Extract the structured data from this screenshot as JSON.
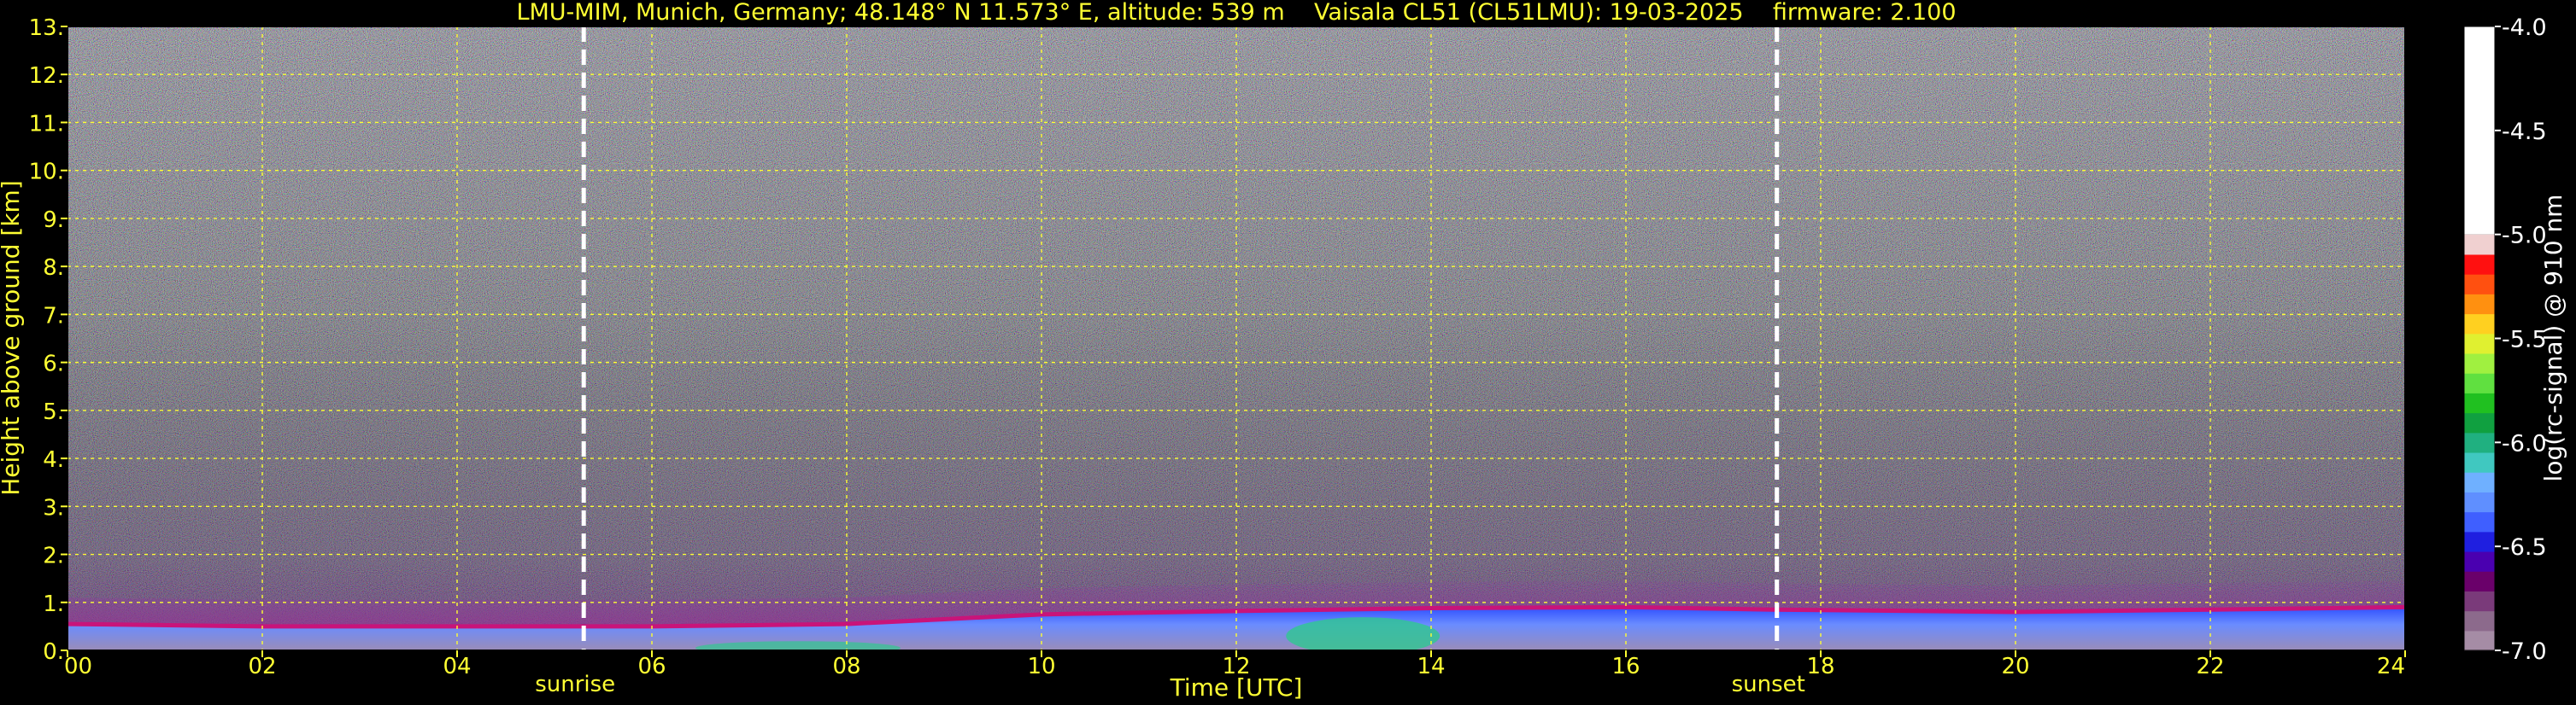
{
  "chart_data": {
    "type": "heatmap",
    "title": "LMU-MIM, Munich, Germany; 48.148° N 11.573° E, altitude: 539 m    Vaisala CL51 (CL51LMU): 19-03-2025    firmware: 2.100",
    "xlabel": "Time [UTC]",
    "ylabel": "Height above ground [km]",
    "xlim": [
      0,
      24
    ],
    "ylim": [
      0,
      13
    ],
    "x_ticks": [
      {
        "value": 0,
        "label": "00"
      },
      {
        "value": 2,
        "label": "02"
      },
      {
        "value": 4,
        "label": "04"
      },
      {
        "value": 6,
        "label": "06"
      },
      {
        "value": 8,
        "label": "08"
      },
      {
        "value": 10,
        "label": "10"
      },
      {
        "value": 12,
        "label": "12"
      },
      {
        "value": 14,
        "label": "14"
      },
      {
        "value": 16,
        "label": "16"
      },
      {
        "value": 18,
        "label": "18"
      },
      {
        "value": 20,
        "label": "20"
      },
      {
        "value": 22,
        "label": "22"
      },
      {
        "value": 24,
        "label": "24"
      }
    ],
    "y_ticks": [
      {
        "value": 0,
        "label": "0."
      },
      {
        "value": 1,
        "label": "1."
      },
      {
        "value": 2,
        "label": "2."
      },
      {
        "value": 3,
        "label": "3."
      },
      {
        "value": 4,
        "label": "4."
      },
      {
        "value": 5,
        "label": "5."
      },
      {
        "value": 6,
        "label": "6."
      },
      {
        "value": 7,
        "label": "7."
      },
      {
        "value": 8,
        "label": "8."
      },
      {
        "value": 9,
        "label": "9."
      },
      {
        "value": 10,
        "label": "10."
      },
      {
        "value": 11,
        "label": "11."
      },
      {
        "value": 12,
        "label": "12."
      },
      {
        "value": 13,
        "label": "13."
      }
    ],
    "grid": true,
    "annotations": [
      {
        "label": "sunrise",
        "time": 5.3
      },
      {
        "label": "sunset",
        "time": 17.55
      }
    ],
    "boundary_layer_top_km": [
      {
        "t": 0,
        "h": 0.55
      },
      {
        "t": 2,
        "h": 0.5
      },
      {
        "t": 4,
        "h": 0.5
      },
      {
        "t": 6,
        "h": 0.5
      },
      {
        "t": 8,
        "h": 0.55
      },
      {
        "t": 9,
        "h": 0.65
      },
      {
        "t": 10,
        "h": 0.75
      },
      {
        "t": 12,
        "h": 0.82
      },
      {
        "t": 14,
        "h": 0.88
      },
      {
        "t": 16,
        "h": 0.9
      },
      {
        "t": 17.5,
        "h": 0.85
      },
      {
        "t": 20,
        "h": 0.8
      },
      {
        "t": 22,
        "h": 0.85
      },
      {
        "t": 24,
        "h": 0.9
      }
    ],
    "colorbar": {
      "label": "log(rc-signal) @ 910 nm",
      "range": [
        -7.0,
        -4.0
      ],
      "ticks": [
        {
          "value": -4.0,
          "label": "-4.0"
        },
        {
          "value": -4.5,
          "label": "-4.5"
        },
        {
          "value": -5.0,
          "label": "-5.0"
        },
        {
          "value": -5.5,
          "label": "-5.5"
        },
        {
          "value": -6.0,
          "label": "-6.0"
        },
        {
          "value": -6.5,
          "label": "-6.5"
        },
        {
          "value": -7.0,
          "label": "-7.0"
        }
      ],
      "colors": [
        "#a58ca5",
        "#8c6a8c",
        "#7a3a7a",
        "#6a006a",
        "#4a00b0",
        "#1f1fe0",
        "#3f5fff",
        "#5f8fff",
        "#6fb0ff",
        "#40c8c0",
        "#20b080",
        "#10a040",
        "#20c020",
        "#60e040",
        "#a0f040",
        "#e0f030",
        "#ffd020",
        "#ff9010",
        "#ff5010",
        "#ff1010",
        "#f0d0d0",
        "#ffffff"
      ]
    }
  }
}
